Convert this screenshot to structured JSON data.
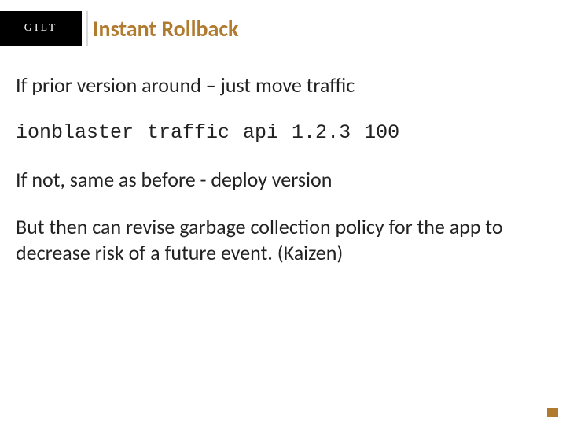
{
  "brand": {
    "logo_text": "GILT"
  },
  "title": "Instant Rollback",
  "body": {
    "p1": "If prior version around – just move traffic",
    "cmd": "ionblaster traffic api 1.2.3 100",
    "p2": "If not, same as before - deploy version",
    "p3": "But then can revise garbage collection policy for the app to decrease risk of a future event. (Kaizen)"
  },
  "colors": {
    "accent": "#b07a2f"
  }
}
